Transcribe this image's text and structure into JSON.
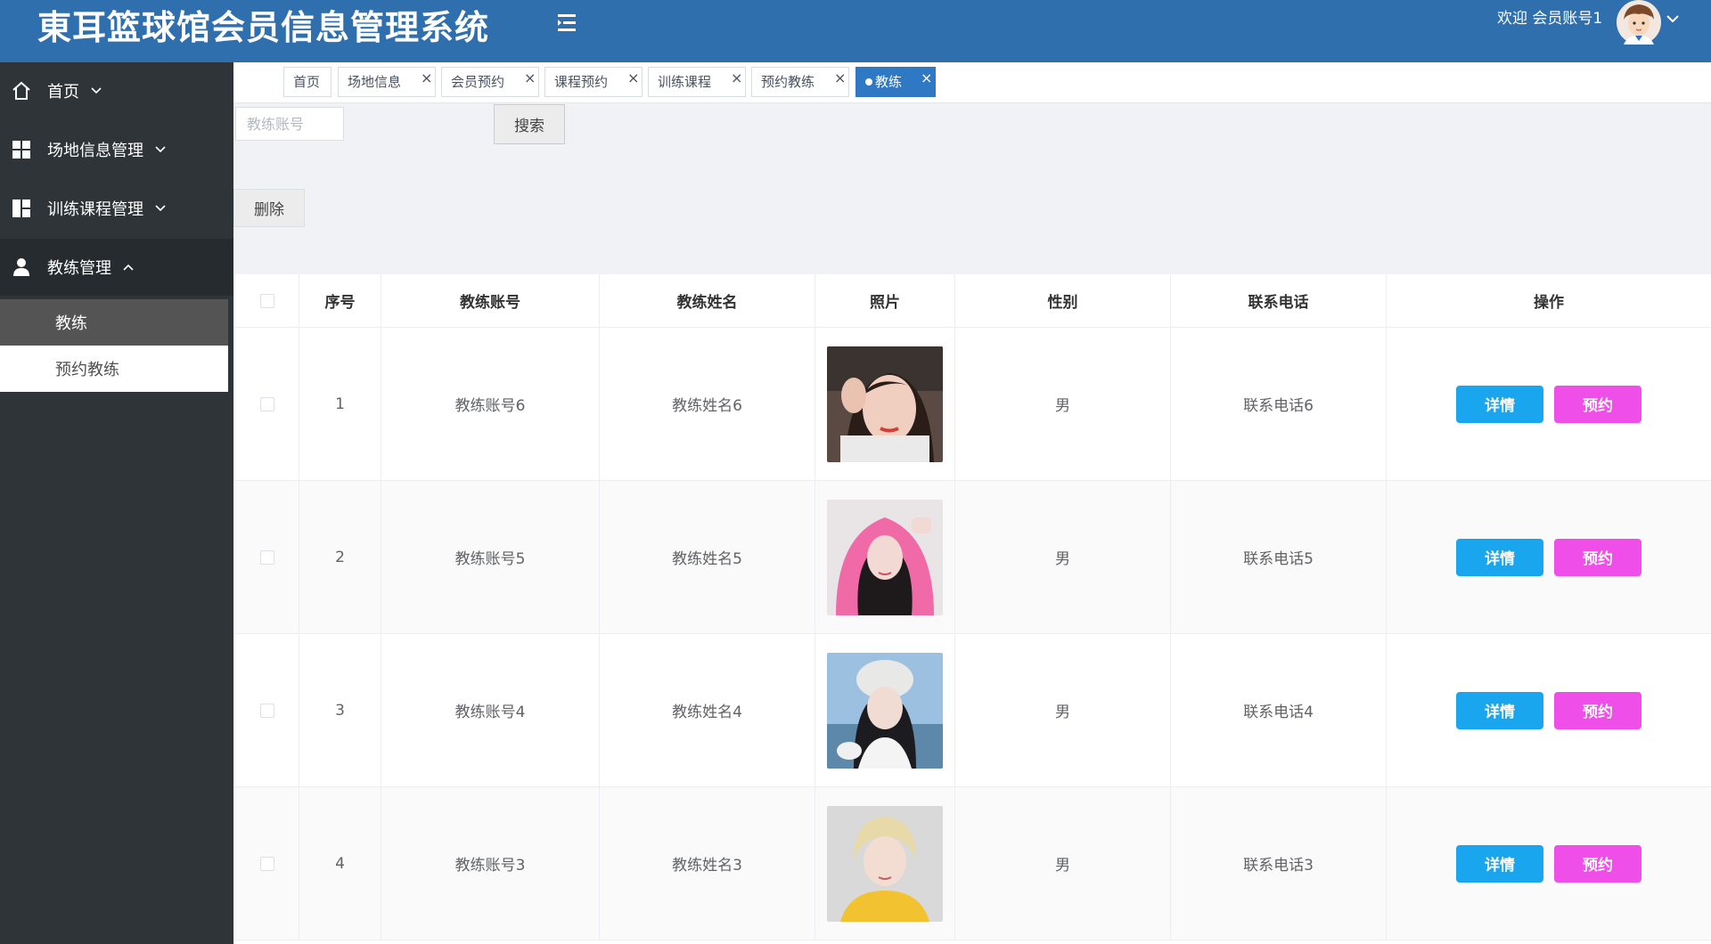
{
  "header": {
    "title": "東耳篮球馆会员信息管理系统",
    "welcome": "欢迎 会员账号1",
    "brand_color": "#2f6fae"
  },
  "sidebar": {
    "items": [
      {
        "label": "首页",
        "icon": "home-icon"
      },
      {
        "label": "场地信息管理",
        "icon": "grid-icon"
      },
      {
        "label": "训练课程管理",
        "icon": "layout-icon"
      },
      {
        "label": "教练管理",
        "icon": "user-icon",
        "expanded": true
      }
    ],
    "submenu": [
      {
        "label": "教练",
        "active": true
      },
      {
        "label": "预约教练",
        "active": false
      }
    ]
  },
  "tabs": [
    {
      "label": "首页",
      "closable": false
    },
    {
      "label": "场地信息",
      "closable": true
    },
    {
      "label": "会员预约",
      "closable": true
    },
    {
      "label": "课程预约",
      "closable": true
    },
    {
      "label": "训练课程",
      "closable": true
    },
    {
      "label": "预约教练",
      "closable": true
    },
    {
      "label": "教练",
      "closable": true,
      "active": true
    }
  ],
  "search": {
    "placeholder": "教练账号",
    "button_label": "搜索"
  },
  "actions": {
    "delete_label": "删除"
  },
  "table": {
    "columns": [
      "序号",
      "教练账号",
      "教练姓名",
      "照片",
      "性别",
      "联系电话",
      "操作"
    ],
    "rows": [
      {
        "index": "1",
        "account": "教练账号6",
        "name": "教练姓名6",
        "gender": "男",
        "phone": "联系电话6"
      },
      {
        "index": "2",
        "account": "教练账号5",
        "name": "教练姓名5",
        "gender": "男",
        "phone": "联系电话5"
      },
      {
        "index": "3",
        "account": "教练账号4",
        "name": "教练姓名4",
        "gender": "男",
        "phone": "联系电话4"
      },
      {
        "index": "4",
        "account": "教练账号3",
        "name": "教练姓名3",
        "gender": "男",
        "phone": "联系电话3"
      }
    ],
    "detail_label": "详情",
    "book_label": "预约"
  },
  "colors": {
    "detail_button": "#1aa6ef",
    "book_button": "#ef4ee8",
    "active_tab": "#2f78c4",
    "sidebar_bg": "#2f3439"
  }
}
